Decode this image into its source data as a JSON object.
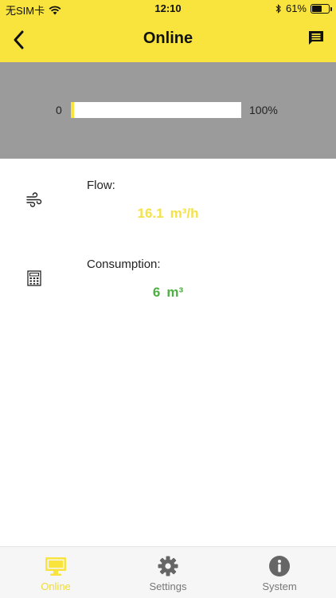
{
  "status": {
    "carrier": "无SIM卡",
    "time": "12:10",
    "battery": "61%"
  },
  "header": {
    "title": "Online"
  },
  "progress": {
    "min_label": "0",
    "max_label": "100%",
    "fill_fraction": 0.02
  },
  "metrics": {
    "flow": {
      "label": "Flow:",
      "value": "16.1",
      "unit": "m³/h",
      "icon": "wind-icon"
    },
    "consumption": {
      "label": "Consumption:",
      "value": "6",
      "unit": "m³",
      "icon": "calculator-icon"
    }
  },
  "tabs": [
    {
      "label": "Online",
      "icon": "monitor-icon",
      "active": true
    },
    {
      "label": "Settings",
      "icon": "gear-icon",
      "active": false
    },
    {
      "label": "System",
      "icon": "info-icon",
      "active": false
    }
  ],
  "colors": {
    "accent": "#F8E43C",
    "flow_value": "#F3E24A",
    "consumption_value": "#4FAE44",
    "band": "#9B9B9B"
  }
}
